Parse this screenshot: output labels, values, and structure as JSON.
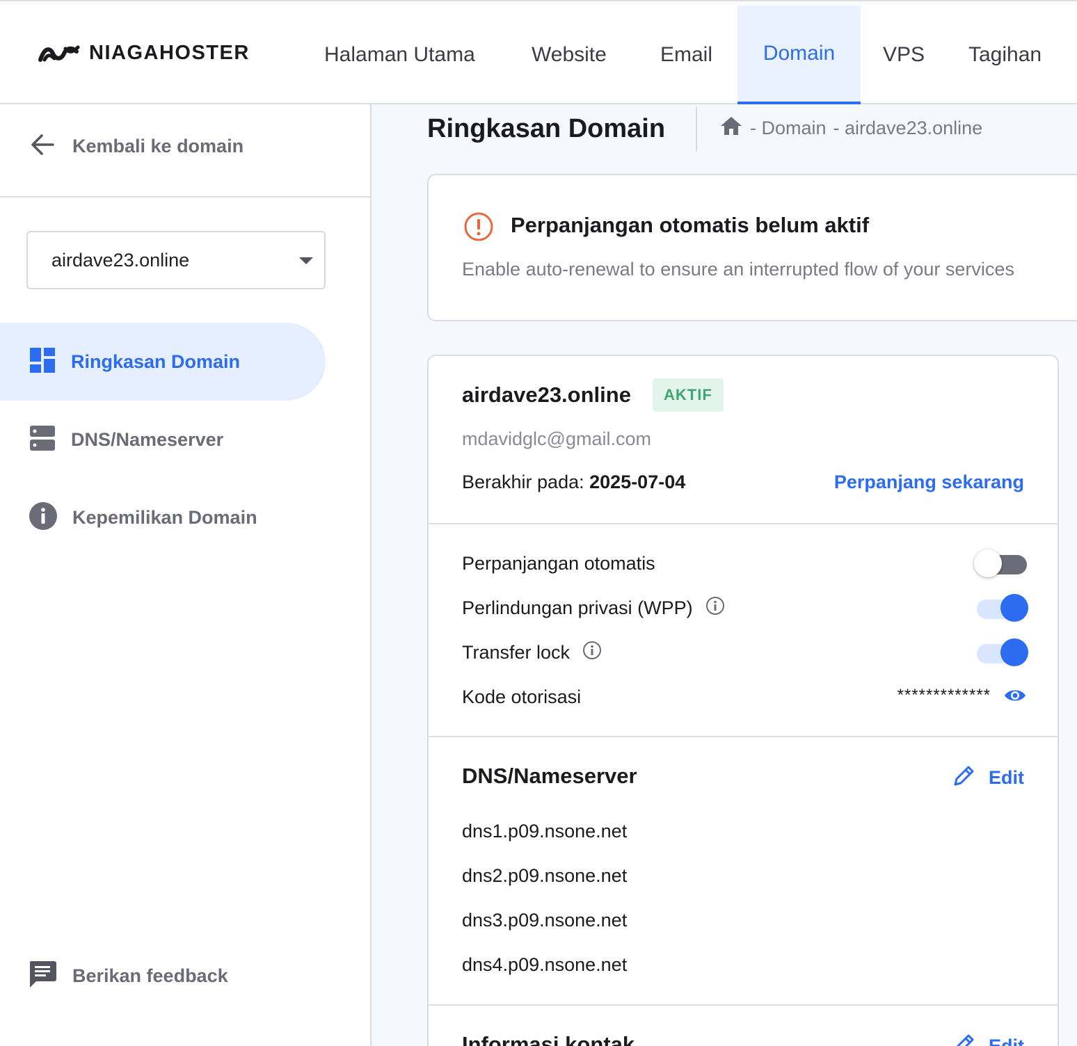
{
  "brand": {
    "name": "NIAGAHOSTER"
  },
  "nav": {
    "items": [
      "Halaman Utama",
      "Website",
      "Email",
      "Domain",
      "VPS",
      "Tagihan"
    ],
    "active": "Domain"
  },
  "sidebar": {
    "back_label": "Kembali ke domain",
    "domain_select": "airdave23.online",
    "items": [
      {
        "label": "Ringkasan Domain",
        "icon": "dashboard-icon",
        "active": true
      },
      {
        "label": "DNS/Nameserver",
        "icon": "server-icon",
        "active": false
      },
      {
        "label": "Kepemilikan Domain",
        "icon": "info-icon",
        "active": false
      }
    ],
    "feedback_label": "Berikan feedback"
  },
  "header": {
    "title": "Ringkasan Domain",
    "breadcrumb": [
      "- Domain",
      "- airdave23.online"
    ]
  },
  "alert": {
    "title": "Perpanjangan otomatis belum aktif",
    "description": "Enable auto-renewal to ensure an interrupted flow of your services"
  },
  "domain": {
    "name": "airdave23.online",
    "status": "AKTIF",
    "email": "mdavidglc@gmail.com",
    "expiry_label": "Berakhir pada:",
    "expiry_date": "2025-07-04",
    "renew_label": "Perpanjang sekarang"
  },
  "settings": {
    "auto_renew": {
      "label": "Perpanjangan otomatis",
      "enabled": false
    },
    "privacy": {
      "label": "Perlindungan privasi (WPP)",
      "enabled": true
    },
    "transfer_lock": {
      "label": "Transfer lock",
      "enabled": true
    },
    "auth_code": {
      "label": "Kode otorisasi",
      "value": "*************"
    }
  },
  "dns": {
    "title": "DNS/Nameserver",
    "edit_label": "Edit",
    "nameservers": [
      "dns1.p09.nsone.net",
      "dns2.p09.nsone.net",
      "dns3.p09.nsone.net",
      "dns4.p09.nsone.net"
    ]
  },
  "contact": {
    "title": "Informasi kontak",
    "edit_label": "Edit"
  },
  "colors": {
    "accent": "#2b6cf0",
    "warning": "#e8683a",
    "success": "#3ea673",
    "muted": "#6b6b78"
  }
}
